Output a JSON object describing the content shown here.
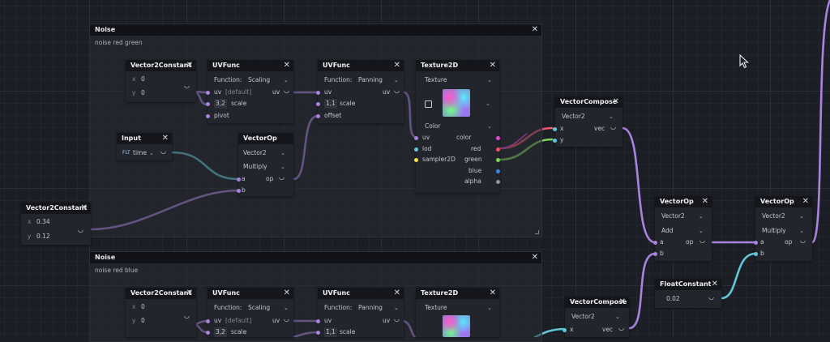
{
  "group_noise1": {
    "title": "Noise",
    "subtitle": "noise red green"
  },
  "group_noise2": {
    "title": "Noise",
    "subtitle": "noise red blue"
  },
  "close_glyph": "✕",
  "node_v2c_top": {
    "title": "Vector2Constant",
    "x_label": "x",
    "x_value": "0",
    "y_label": "y",
    "y_value": "0"
  },
  "node_uvfunc1": {
    "title": "UVFunc",
    "function_label": "Function:",
    "function_value": "Scaling",
    "uv_label": "uv",
    "uv_default": "[default]",
    "uv_out": "uv",
    "scale_value": "3,2",
    "scale_label": "scale",
    "pivot_label": "pivot"
  },
  "node_uvfunc2": {
    "title": "UVFunc",
    "function_label": "Function:",
    "function_value": "Panning",
    "uv_label": "uv",
    "uv_out": "uv",
    "scale_value": "1,1",
    "scale_label": "scale",
    "offset_label": "offset"
  },
  "node_tex1": {
    "title": "Texture2D",
    "type_value": "Texture",
    "color_value": "Color",
    "uv_label": "uv",
    "lod_label": "lod",
    "sampler_label": "sampler2D",
    "outputs": [
      "color",
      "red",
      "green",
      "blue",
      "alpha"
    ]
  },
  "node_input": {
    "title": "Input",
    "badge": "FLT",
    "value": "time"
  },
  "node_vectorop1": {
    "title": "VectorOp",
    "type_value": "Vector2",
    "op_value": "Multiply",
    "a_label": "a",
    "b_label": "b",
    "out_label": "op"
  },
  "node_v2c_left": {
    "title": "Vector2Constant",
    "x_label": "x",
    "x_value": "0.34",
    "y_label": "y",
    "y_value": "0.12"
  },
  "node_vcompose1": {
    "title": "VectorCompose",
    "type_value": "Vector2",
    "x_label": "x",
    "y_label": "y",
    "out_label": "vec"
  },
  "node_vectorop_add": {
    "title": "VectorOp",
    "type_value": "Vector2",
    "op_value": "Add",
    "a_label": "a",
    "b_label": "b",
    "out_label": "op"
  },
  "node_vectorop_mul": {
    "title": "VectorOp",
    "type_value": "Vector2",
    "op_value": "Multiply",
    "a_label": "a",
    "b_label": "b",
    "out_label": "op"
  },
  "node_float": {
    "title": "FloatConstant",
    "value": "0.02"
  },
  "node_v2c_bottom": {
    "title": "Vector2Constant",
    "x_label": "x",
    "x_value": "0",
    "y_label": "y",
    "y_value": "0"
  },
  "node_uvfunc3": {
    "title": "UVFunc",
    "function_label": "Function:",
    "function_value": "Scaling",
    "uv_label": "uv",
    "uv_default": "[default]",
    "uv_out": "uv",
    "scale_value": "3,2",
    "scale_label": "scale"
  },
  "node_uvfunc4": {
    "title": "UVFunc",
    "function_label": "Function:",
    "function_value": "Panning",
    "uv_label": "uv",
    "uv_out": "uv",
    "scale_value": "1,1",
    "scale_label": "scale"
  },
  "node_tex2": {
    "title": "Texture2D",
    "type_value": "Texture"
  },
  "node_vcompose2": {
    "title": "VectorCompose",
    "type_value": "Vector2",
    "x_label": "x",
    "out_label": "vec"
  },
  "icons": {
    "close": "close-icon",
    "dropdown": "chevron-down-icon",
    "output": "output-port-icon",
    "image": "image-icon",
    "cursor": "mouse-pointer-icon"
  },
  "colors": {
    "wire_vector": "#a983dd",
    "wire_float": "#61c7d6",
    "port_color": "#e44bd0",
    "port_red": "#f0556a",
    "port_green": "#7fd55a",
    "port_blue": "#3f84e6",
    "port_sampler": "#f2e23a"
  }
}
